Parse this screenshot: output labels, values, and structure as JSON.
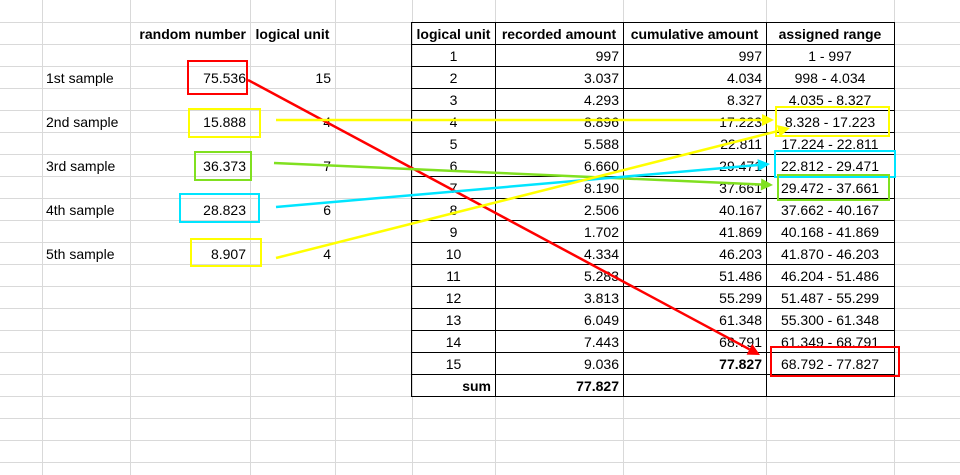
{
  "left_headers": {
    "random_number": "random number",
    "logical_unit": "logical unit"
  },
  "samples": [
    {
      "label": "1st sample",
      "random": "75.536",
      "unit": "15",
      "color": "#ff0000"
    },
    {
      "label": "2nd sample",
      "random": "15.888",
      "unit": "4",
      "color": "#ffff00"
    },
    {
      "label": "3rd sample",
      "random": "36.373",
      "unit": "7",
      "color": "#80e020"
    },
    {
      "label": "4th sample",
      "random": "28.823",
      "unit": "6",
      "color": "#00e5ff"
    },
    {
      "label": "5th sample",
      "random": "8.907",
      "unit": "4",
      "color": "#ffff00"
    }
  ],
  "table": {
    "headers": [
      "logical unit",
      "recorded amount",
      "cumulative amount",
      "assigned range"
    ],
    "rows": [
      {
        "unit": "1",
        "recorded": "997",
        "cumulative": "997",
        "range": "1 - 997"
      },
      {
        "unit": "2",
        "recorded": "3.037",
        "cumulative": "4.034",
        "range": "998 - 4.034"
      },
      {
        "unit": "3",
        "recorded": "4.293",
        "cumulative": "8.327",
        "range": "4.035 - 8.327"
      },
      {
        "unit": "4",
        "recorded": "8.896",
        "cumulative": "17.223",
        "range": "8.328 - 17.223"
      },
      {
        "unit": "5",
        "recorded": "5.588",
        "cumulative": "22.811",
        "range": "17.224 - 22.811"
      },
      {
        "unit": "6",
        "recorded": "6.660",
        "cumulative": "29.471",
        "range": "22.812 - 29.471"
      },
      {
        "unit": "7",
        "recorded": "8.190",
        "cumulative": "37.661",
        "range": "29.472 - 37.661"
      },
      {
        "unit": "8",
        "recorded": "2.506",
        "cumulative": "40.167",
        "range": "37.662 - 40.167"
      },
      {
        "unit": "9",
        "recorded": "1.702",
        "cumulative": "41.869",
        "range": "40.168 - 41.869"
      },
      {
        "unit": "10",
        "recorded": "4.334",
        "cumulative": "46.203",
        "range": "41.870 - 46.203"
      },
      {
        "unit": "11",
        "recorded": "5.283",
        "cumulative": "51.486",
        "range": "46.204 - 51.486"
      },
      {
        "unit": "12",
        "recorded": "3.813",
        "cumulative": "55.299",
        "range": "51.487 - 55.299"
      },
      {
        "unit": "13",
        "recorded": "6.049",
        "cumulative": "61.348",
        "range": "55.300 - 61.348"
      },
      {
        "unit": "14",
        "recorded": "7.443",
        "cumulative": "68.791",
        "range": "61.349 - 68.791"
      },
      {
        "unit": "15",
        "recorded": "9.036",
        "cumulative": "77.827",
        "range": "68.792 - 77.827"
      }
    ],
    "sum_label": "sum",
    "sum_value": "77.827"
  },
  "colors": {
    "red": "#ff0000",
    "yellow": "#ffff00",
    "green": "#80e020",
    "cyan": "#00e5ff",
    "gridline": "#d9d9d9"
  }
}
